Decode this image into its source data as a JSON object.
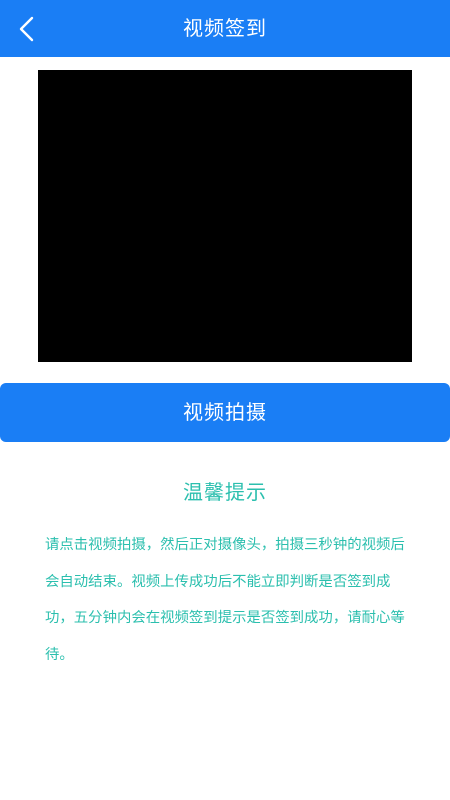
{
  "header": {
    "title": "视频签到",
    "back_icon": "chevron-left-icon"
  },
  "video_preview": {
    "state": "empty"
  },
  "actions": {
    "record_label": "视频拍摄"
  },
  "tips": {
    "title": "温馨提示",
    "body": "请点击视频拍摄，然后正对摄像头，拍摄三秒钟的视频后会自动结束。视频上传成功后不能立即判断是否签到成功，五分钟内会在视频签到提示是否签到成功，请耐心等待。"
  },
  "colors": {
    "primary": "#1a7ef5",
    "tip_text": "#2bbfae",
    "preview_bg": "#000000"
  }
}
